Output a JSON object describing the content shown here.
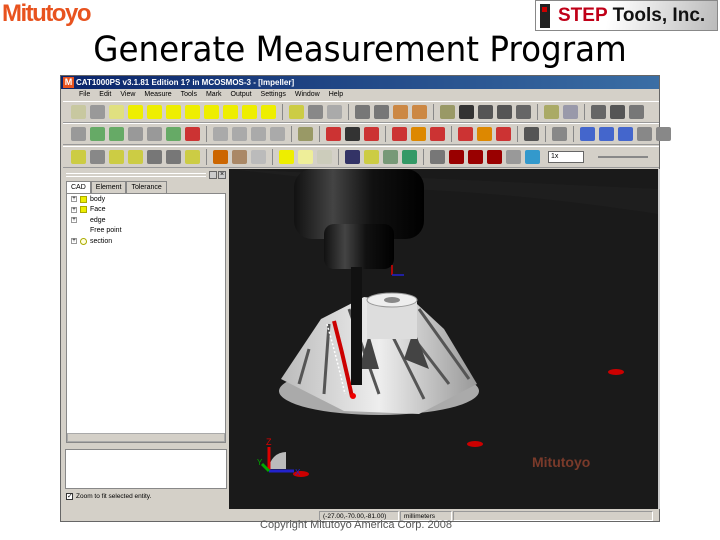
{
  "slide": {
    "title": "Generate Measurement Program",
    "copyright": "Copyright  Mitutoyo America Corp. 2008",
    "logo_left": "Mitutoyo",
    "logo_right_a": "STEP",
    "logo_right_b": "Tools, Inc."
  },
  "app": {
    "title": "CAT1000PS v3.1.81 Edition 1? in MCOSMOS-3 - [Impeller]",
    "menu": [
      "File",
      "Edit",
      "View",
      "Measure",
      "Tools",
      "Mark",
      "Output",
      "Settings",
      "Window",
      "Help"
    ],
    "toolbar_rows": [
      [
        "#c8c8a0",
        "#999",
        "#e0e080",
        "#ee0",
        "#ee0",
        "#ee0",
        "#ee0",
        "#ee0",
        "#ee0",
        "#ee0",
        "#ee0",
        "|",
        "#cc4",
        "#888",
        "#aaa",
        "|",
        "#777",
        "#777",
        "#c84",
        "#c84",
        "|",
        "#996",
        "#333",
        "#555",
        "#555",
        "#666",
        "|",
        "#aa6",
        "#99a",
        "|",
        "#666",
        "#555",
        "#777"
      ],
      [
        "#999",
        "#6a6",
        "#6a6",
        "#999",
        "#999",
        "#6a6",
        "#c33",
        "|",
        "#aaa",
        "#aaa",
        "#aaa",
        "#aaa",
        "|",
        "#996",
        "|",
        "#c33",
        "#333",
        "#c33",
        "|",
        "#c33",
        "#d80",
        "#c33",
        "|",
        "#c33",
        "#d80",
        "#c33",
        "|",
        "#555",
        "|",
        "#888",
        "|",
        "#46c",
        "#46c",
        "#46c",
        "#888",
        "#888"
      ],
      [
        "#cc4",
        "#888",
        "#cc4",
        "#cc4",
        "#777",
        "#777",
        "#cc4",
        "|",
        "#c60",
        "#a86",
        "#bbb",
        "|",
        "#ee0",
        "#ee9",
        "#ccb",
        "|",
        "#336",
        "#cc4",
        "#797",
        "#396",
        "|",
        "#777",
        "#900",
        "#900",
        "#900",
        "#999",
        "#39c"
      ]
    ],
    "speed": "1x",
    "panel_tabs": [
      "CAD",
      "Element",
      "Tolerance"
    ],
    "tree": [
      {
        "label": "body",
        "icon": "folder"
      },
      {
        "label": "Face",
        "icon": "folder"
      },
      {
        "label": "edge",
        "icon": "edge"
      },
      {
        "label": "Free point",
        "icon": "point"
      },
      {
        "label": "section",
        "icon": "section"
      }
    ],
    "zoom_fit_label": "Zoom to fit selected entity.",
    "zoom_fit_checked": true,
    "coords": "(-27.00,-70.00,-81.00)",
    "units": "millimeters",
    "watermark": "Mitutoyo",
    "axis_labels": {
      "z": "Z",
      "y": "Y",
      "x": "X"
    }
  }
}
